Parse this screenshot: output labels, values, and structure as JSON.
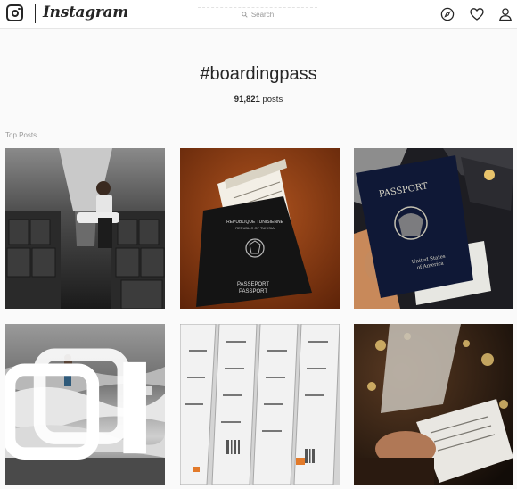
{
  "header": {
    "wordmark": "Instagram",
    "search_placeholder": "Search",
    "icons": [
      "instagram-logo-icon",
      "search-icon",
      "explore-compass-icon",
      "heart-icon",
      "profile-icon"
    ]
  },
  "hashtag": {
    "title": "#boardingpass",
    "post_count": "91,821",
    "post_count_suffix": " posts"
  },
  "top_posts_label": "Top Posts",
  "posts": [
    {
      "subject": "airplane-cabin",
      "passport_lines": []
    },
    {
      "subject": "tunisia-passport",
      "passport_lines": [
        "REPUBLIQUE TUNISIENNE",
        "REPUBLIC OF TUNISIA",
        "PASSEPORT",
        "PASSPORT"
      ]
    },
    {
      "subject": "us-passport",
      "passport_lines": [
        "PASSPORT",
        "United States",
        "of America"
      ]
    },
    {
      "subject": "beach-waves",
      "passport_lines": [],
      "badge": "multiple-photos-icon"
    },
    {
      "subject": "boarding-pass-stack",
      "passport_lines": []
    },
    {
      "subject": "boarding-pass-night",
      "passport_lines": []
    }
  ],
  "colors": {
    "background": "#fafafa",
    "text": "#262626",
    "secondary": "#999999"
  }
}
